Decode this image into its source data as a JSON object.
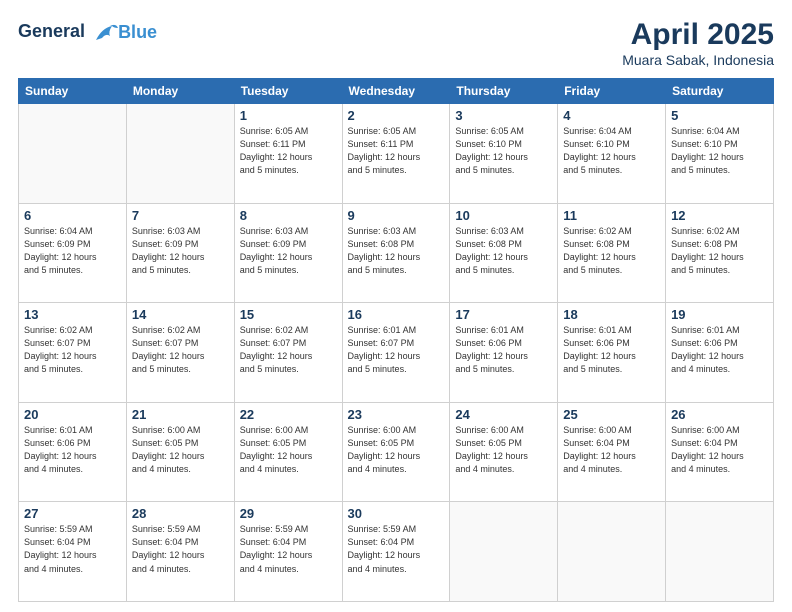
{
  "header": {
    "logo_line1": "General",
    "logo_line2": "Blue",
    "month": "April 2025",
    "location": "Muara Sabak, Indonesia"
  },
  "weekdays": [
    "Sunday",
    "Monday",
    "Tuesday",
    "Wednesday",
    "Thursday",
    "Friday",
    "Saturday"
  ],
  "weeks": [
    [
      {
        "day": "",
        "info": ""
      },
      {
        "day": "",
        "info": ""
      },
      {
        "day": "1",
        "info": "Sunrise: 6:05 AM\nSunset: 6:11 PM\nDaylight: 12 hours\nand 5 minutes."
      },
      {
        "day": "2",
        "info": "Sunrise: 6:05 AM\nSunset: 6:11 PM\nDaylight: 12 hours\nand 5 minutes."
      },
      {
        "day": "3",
        "info": "Sunrise: 6:05 AM\nSunset: 6:10 PM\nDaylight: 12 hours\nand 5 minutes."
      },
      {
        "day": "4",
        "info": "Sunrise: 6:04 AM\nSunset: 6:10 PM\nDaylight: 12 hours\nand 5 minutes."
      },
      {
        "day": "5",
        "info": "Sunrise: 6:04 AM\nSunset: 6:10 PM\nDaylight: 12 hours\nand 5 minutes."
      }
    ],
    [
      {
        "day": "6",
        "info": "Sunrise: 6:04 AM\nSunset: 6:09 PM\nDaylight: 12 hours\nand 5 minutes."
      },
      {
        "day": "7",
        "info": "Sunrise: 6:03 AM\nSunset: 6:09 PM\nDaylight: 12 hours\nand 5 minutes."
      },
      {
        "day": "8",
        "info": "Sunrise: 6:03 AM\nSunset: 6:09 PM\nDaylight: 12 hours\nand 5 minutes."
      },
      {
        "day": "9",
        "info": "Sunrise: 6:03 AM\nSunset: 6:08 PM\nDaylight: 12 hours\nand 5 minutes."
      },
      {
        "day": "10",
        "info": "Sunrise: 6:03 AM\nSunset: 6:08 PM\nDaylight: 12 hours\nand 5 minutes."
      },
      {
        "day": "11",
        "info": "Sunrise: 6:02 AM\nSunset: 6:08 PM\nDaylight: 12 hours\nand 5 minutes."
      },
      {
        "day": "12",
        "info": "Sunrise: 6:02 AM\nSunset: 6:08 PM\nDaylight: 12 hours\nand 5 minutes."
      }
    ],
    [
      {
        "day": "13",
        "info": "Sunrise: 6:02 AM\nSunset: 6:07 PM\nDaylight: 12 hours\nand 5 minutes."
      },
      {
        "day": "14",
        "info": "Sunrise: 6:02 AM\nSunset: 6:07 PM\nDaylight: 12 hours\nand 5 minutes."
      },
      {
        "day": "15",
        "info": "Sunrise: 6:02 AM\nSunset: 6:07 PM\nDaylight: 12 hours\nand 5 minutes."
      },
      {
        "day": "16",
        "info": "Sunrise: 6:01 AM\nSunset: 6:07 PM\nDaylight: 12 hours\nand 5 minutes."
      },
      {
        "day": "17",
        "info": "Sunrise: 6:01 AM\nSunset: 6:06 PM\nDaylight: 12 hours\nand 5 minutes."
      },
      {
        "day": "18",
        "info": "Sunrise: 6:01 AM\nSunset: 6:06 PM\nDaylight: 12 hours\nand 5 minutes."
      },
      {
        "day": "19",
        "info": "Sunrise: 6:01 AM\nSunset: 6:06 PM\nDaylight: 12 hours\nand 4 minutes."
      }
    ],
    [
      {
        "day": "20",
        "info": "Sunrise: 6:01 AM\nSunset: 6:06 PM\nDaylight: 12 hours\nand 4 minutes."
      },
      {
        "day": "21",
        "info": "Sunrise: 6:00 AM\nSunset: 6:05 PM\nDaylight: 12 hours\nand 4 minutes."
      },
      {
        "day": "22",
        "info": "Sunrise: 6:00 AM\nSunset: 6:05 PM\nDaylight: 12 hours\nand 4 minutes."
      },
      {
        "day": "23",
        "info": "Sunrise: 6:00 AM\nSunset: 6:05 PM\nDaylight: 12 hours\nand 4 minutes."
      },
      {
        "day": "24",
        "info": "Sunrise: 6:00 AM\nSunset: 6:05 PM\nDaylight: 12 hours\nand 4 minutes."
      },
      {
        "day": "25",
        "info": "Sunrise: 6:00 AM\nSunset: 6:04 PM\nDaylight: 12 hours\nand 4 minutes."
      },
      {
        "day": "26",
        "info": "Sunrise: 6:00 AM\nSunset: 6:04 PM\nDaylight: 12 hours\nand 4 minutes."
      }
    ],
    [
      {
        "day": "27",
        "info": "Sunrise: 5:59 AM\nSunset: 6:04 PM\nDaylight: 12 hours\nand 4 minutes."
      },
      {
        "day": "28",
        "info": "Sunrise: 5:59 AM\nSunset: 6:04 PM\nDaylight: 12 hours\nand 4 minutes."
      },
      {
        "day": "29",
        "info": "Sunrise: 5:59 AM\nSunset: 6:04 PM\nDaylight: 12 hours\nand 4 minutes."
      },
      {
        "day": "30",
        "info": "Sunrise: 5:59 AM\nSunset: 6:04 PM\nDaylight: 12 hours\nand 4 minutes."
      },
      {
        "day": "",
        "info": ""
      },
      {
        "day": "",
        "info": ""
      },
      {
        "day": "",
        "info": ""
      }
    ]
  ]
}
